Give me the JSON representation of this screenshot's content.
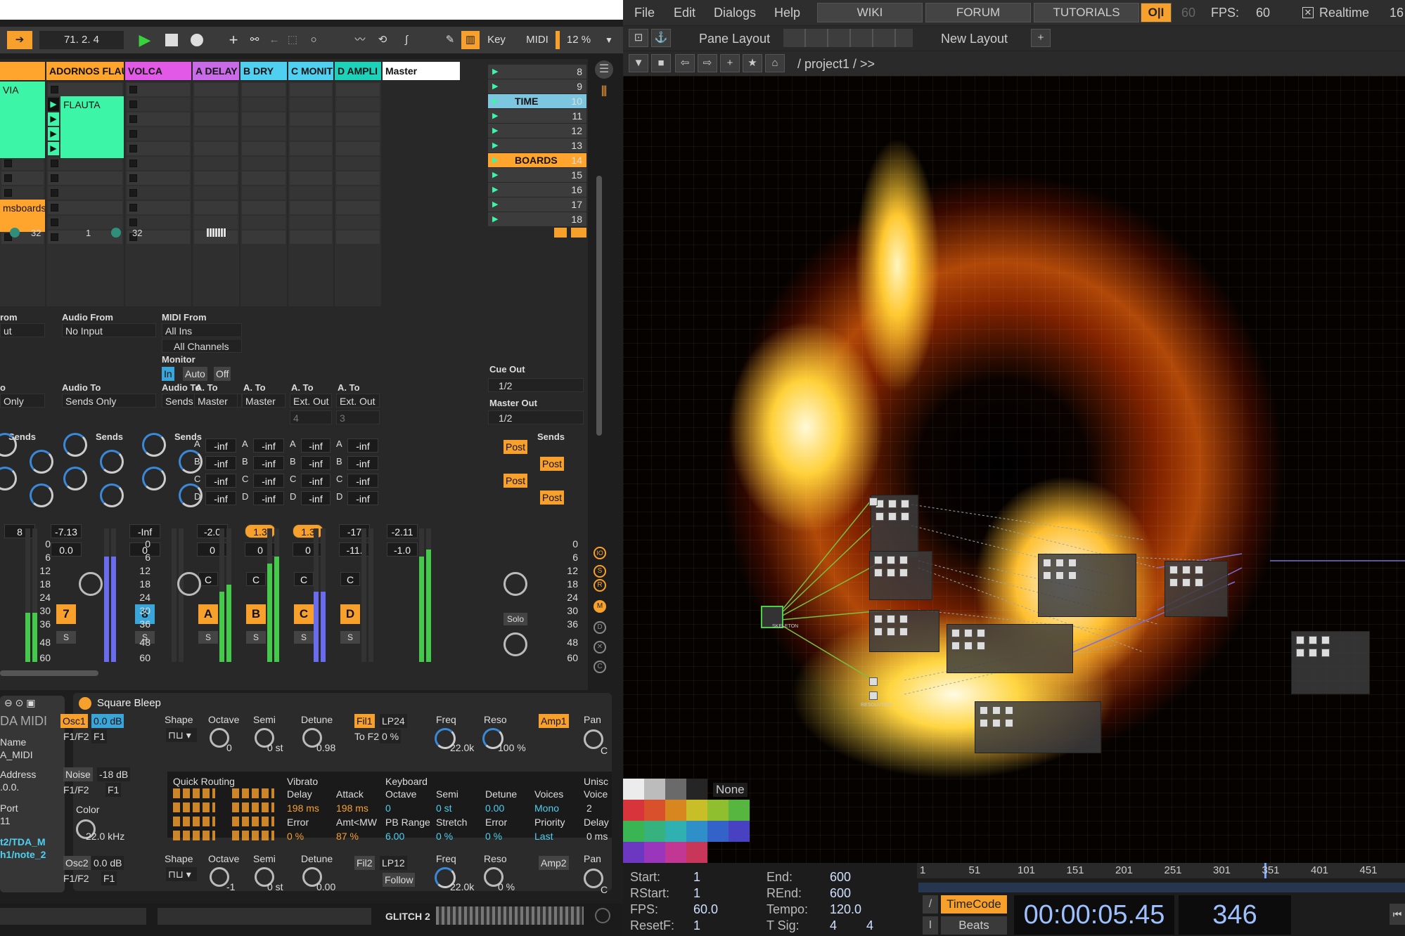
{
  "ableton": {
    "transport": {
      "position": "71.  2.  4",
      "key_label": "Key",
      "midi_label": "MIDI",
      "cpu": "12 %"
    },
    "tracks": [
      {
        "name": "",
        "color": "#ffa52e"
      },
      {
        "name": "ADORNOS FLAUT",
        "color": "#ffa52e"
      },
      {
        "name": "VOLCA",
        "color": "#e159e6"
      },
      {
        "name": "A DELAY",
        "color": "#c96be8"
      },
      {
        "name": "B DRY",
        "color": "#4fd0f0"
      },
      {
        "name": "C MONIT",
        "color": "#4fd0f0"
      },
      {
        "name": "D AMPLI",
        "color": "#1ed2b9"
      },
      {
        "name": "Master",
        "color": "#ffffff"
      }
    ],
    "clips": {
      "via": "VIA",
      "flauta": "FLAUTA",
      "boards": "msboardsFi"
    },
    "scenes": [
      {
        "label": "",
        "num": "8"
      },
      {
        "label": "",
        "num": "9"
      },
      {
        "label": "TIME",
        "num": "10"
      },
      {
        "label": "",
        "num": "11"
      },
      {
        "label": "",
        "num": "12"
      },
      {
        "label": "",
        "num": "13"
      },
      {
        "label": "BOARDS",
        "num": "14"
      },
      {
        "label": "",
        "num": "15"
      },
      {
        "label": "",
        "num": "16"
      },
      {
        "label": "",
        "num": "17"
      },
      {
        "label": "",
        "num": "18"
      }
    ],
    "io": {
      "t0_from": "rom",
      "t0_in": "ut",
      "t0_to": "o",
      "t0_out": "Only",
      "audio_from": "Audio From",
      "no_input": "No Input",
      "audio_to": "Audio To",
      "sends_only": "Sends Only",
      "midi_from": "MIDI From",
      "all_ins": "All Ins",
      "all_channels": "All Channels",
      "monitor": "Monitor",
      "mon_in": "In",
      "mon_auto": "Auto",
      "mon_off": "Off",
      "a_to": "A. To",
      "master": "Master",
      "ext_out": "Ext. Out",
      "ch4": "4",
      "ch3": "3",
      "cue_out": "Cue Out",
      "cue_val": "1/2",
      "master_out": "Master Out",
      "master_val": "1/2",
      "num1": "1",
      "num32": "32"
    },
    "sends_label": "Sends",
    "post": "Post",
    "neg_inf": "-inf",
    "send_letters": [
      "A",
      "B",
      "C",
      "D"
    ],
    "volumes": [
      "8",
      "-7.13",
      "-Inf",
      "-2.0",
      "1.3",
      "1.3",
      "-17",
      "-2.11"
    ],
    "pans": [
      "",
      "0.0",
      "0",
      "0",
      "0",
      "0",
      "-11.",
      "-1.0"
    ],
    "track_numbers": [
      "",
      "7",
      "8",
      "A",
      "B",
      "C",
      "D",
      ""
    ],
    "pan_letters": [
      "",
      "",
      "",
      "C",
      "C",
      "C",
      "C",
      ""
    ],
    "solo_label": "S",
    "solo_master": "Solo",
    "scale": [
      "0",
      "6",
      "12",
      "18",
      "24",
      "30",
      "36",
      "48",
      "60"
    ],
    "device": {
      "left_title": "DA MIDI",
      "name": "Name",
      "name_val": "A_MIDI",
      "address": "Address",
      "addr_val": ".0.0.",
      "port": "Port",
      "port_val": "11",
      "path1": "t2/TDA_M",
      "path2": "h1/note_2",
      "title": "Square Bleep",
      "osc1": "Osc1",
      "osc1_db": "0.0 dB",
      "shape": "Shape",
      "octave": "Octave",
      "semi": "Semi",
      "detune": "Detune",
      "f1f2": "F1/F2",
      "f1": "F1",
      "oct_val": "0",
      "semi_val": "0 st",
      "det_val": "0.98",
      "fil1": "Fil1",
      "lp24": "LP24",
      "freq": "Freq",
      "reso": "Reso",
      "tof2": "To F2",
      "tof2_val": "0 %",
      "freq_val": "22.0k",
      "reso_val": "100 %",
      "amp1": "Amp1",
      "pan": "Pan",
      "pan_val": "C",
      "noise": "Noise",
      "noise_db": "-18 dB",
      "color": "Color",
      "color_val": "22.0 kHz",
      "quick_routing": "Quick Routing",
      "vibrato": "Vibrato",
      "delay": "Delay",
      "delay_val": "198 ms",
      "attack": "Attack",
      "attack_val": "198 ms",
      "error": "Error",
      "error_val": "0 %",
      "amt": "Amt<MW",
      "amt_val": "87 %",
      "keyboard": "Keyboard",
      "k_octave": "Octave",
      "k_oct_val": "0",
      "pb_range": "PB Range",
      "pb_val": "6.00",
      "k_semi": "Semi",
      "k_semi_val": "0 st",
      "stretch": "Stretch",
      "stretch_val": "0 %",
      "k_detune": "Detune",
      "k_det_val": "0.00",
      "k_error": "Error",
      "k_err_val": "0 %",
      "voices": "Voices",
      "voices_val": "Mono",
      "priority": "Priority",
      "priority_val": "Last",
      "unison": "Unisc",
      "uvoice": "Voice",
      "uvoice_val": "2",
      "udelay": "Delay",
      "udelay_val": "0 ms",
      "osc2": "Osc2",
      "osc2_db": "0.0 dB",
      "oct2_val": "-1",
      "semi2_val": "0 st",
      "det2_val": "0.00",
      "fil2": "Fil2",
      "lp12": "LP12",
      "follow": "Follow",
      "freq2_val": "22.0k",
      "reso2_val": "0 %",
      "amp2": "Amp2",
      "pan2_val": "C"
    },
    "glitch": "GLITCH 2"
  },
  "td": {
    "menu": [
      "File",
      "Edit",
      "Dialogs",
      "Help"
    ],
    "tabs": [
      "WIKI",
      "FORUM",
      "TUTORIALS"
    ],
    "oi": "O|I",
    "fps_num": "60",
    "fps_label": "FPS:",
    "fps_val": "60",
    "realtime": "Realtime",
    "extra": "16",
    "pane_layout": "Pane Layout",
    "new_layout": "New Layout",
    "path": "/ project1 / >>",
    "node_labels": [
      "SKELETON",
      "RESOLUTION"
    ],
    "none_label": "None",
    "swatches": [
      "#ececec",
      "#bcbcbc",
      "#6a6a6a",
      "#252525",
      "#d7343b",
      "#d9512c",
      "#d8861f",
      "#c8be27",
      "#8fbf2e",
      "#56b63f",
      "#3ab553",
      "#35b27e",
      "#30b0b0",
      "#2f8fc8",
      "#3362c8",
      "#4841c2",
      "#6c38c2",
      "#9a36bc",
      "#c23694",
      "#c8365a"
    ],
    "stats": {
      "start_l": "Start:",
      "start": "1",
      "rstart_l": "RStart:",
      "rstart": "1",
      "fps_l": "FPS:",
      "fps": "60.0",
      "resetf_l": "ResetF:",
      "resetf": "1",
      "end_l": "End:",
      "end": "600",
      "rend_l": "REnd:",
      "rend": "600",
      "tempo_l": "Tempo:",
      "tempo": "120.0",
      "tsig_l": "T Sig:",
      "tsig1": "4",
      "tsig2": "4"
    },
    "ruler": [
      "1",
      "51",
      "101",
      "151",
      "201",
      "251",
      "301",
      "351",
      "401",
      "451"
    ],
    "timecode_label": "TimeCode",
    "beats_label": "Beats",
    "timecode": "00:00:05.45",
    "frame": "346"
  }
}
